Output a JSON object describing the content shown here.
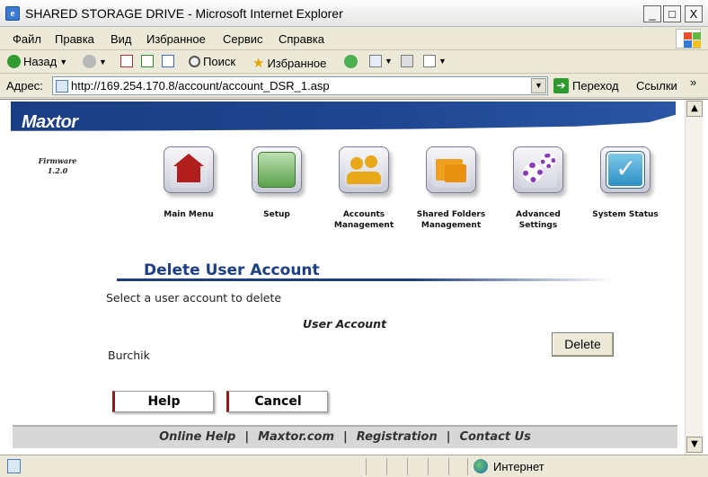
{
  "window": {
    "title": "SHARED STORAGE DRIVE - Microsoft Internet Explorer",
    "app_icon": "e",
    "minimize": "_",
    "maximize": "□",
    "close": "X"
  },
  "menubar": {
    "items": [
      "Файл",
      "Правка",
      "Вид",
      "Избранное",
      "Сервис",
      "Справка"
    ]
  },
  "toolbar": {
    "back_label": "Назад",
    "search_label": "Поиск",
    "favorites_label": "Избранное"
  },
  "address": {
    "label": "Адрес:",
    "url": "http://169.254.170.8/account/account_DSR_1.asp",
    "go_label": "Переход",
    "links_label": "Ссылки",
    "more": "»"
  },
  "page": {
    "logo": "Maxtor",
    "firmware_label": "Firmware",
    "firmware_version": "1.2.0",
    "nav": [
      {
        "label": "Main Menu"
      },
      {
        "label": "Setup"
      },
      {
        "label": "Accounts Management"
      },
      {
        "label": "Shared Folders Management"
      },
      {
        "label": "Advanced Settings"
      },
      {
        "label": "System Status"
      }
    ],
    "section_title": "Delete User Account",
    "section_desc": "Select a user account to delete",
    "column_header": "User Account",
    "user": "Burchik",
    "delete_button": "Delete",
    "help_button": "Help",
    "cancel_button": "Cancel",
    "footer_links": [
      "Online Help",
      "Maxtor.com",
      "Registration",
      "Contact Us"
    ],
    "footer_separator": "|"
  },
  "statusbar": {
    "zone": "Интернет"
  },
  "colors": {
    "brand_blue": "#1c3e85",
    "footer_grey": "#d7d7d7"
  }
}
